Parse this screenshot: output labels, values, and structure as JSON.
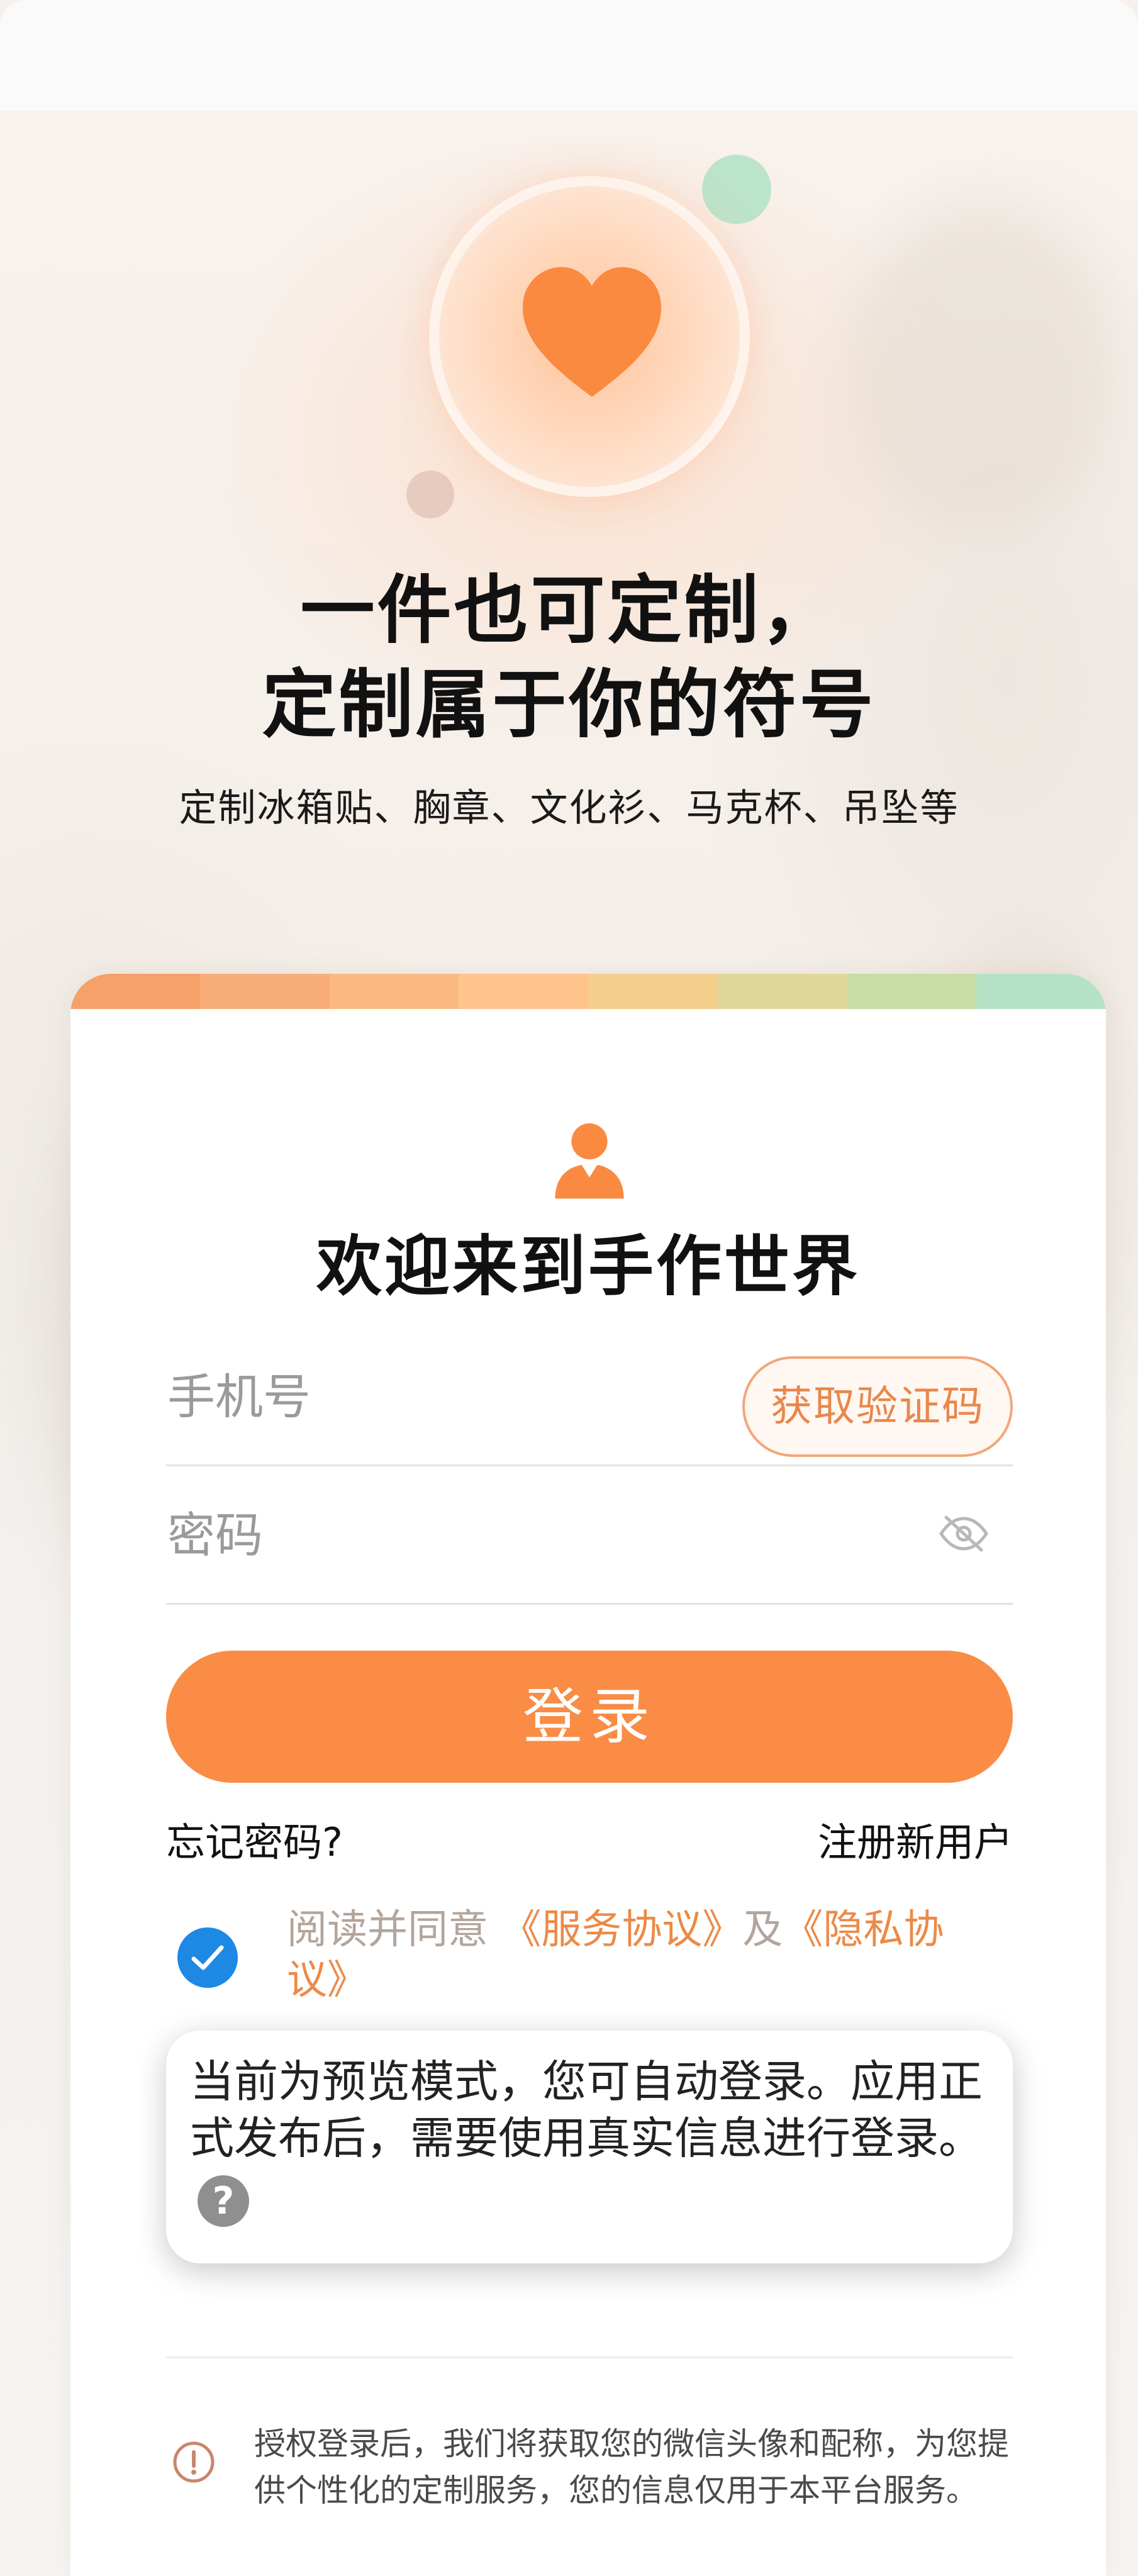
{
  "hero": {
    "headline_line1": "一件也可定制，",
    "headline_line2": "定制属于你的符号",
    "subtitle": "定制冰箱贴、胸章、文化衫、马克杯、吊坠等"
  },
  "login": {
    "welcome_title": "欢迎来到手作世界",
    "phone_placeholder": "手机号",
    "get_code_label": "获取验证码",
    "password_placeholder": "密码",
    "login_button": "登录",
    "forgot_password": "忘记密码?",
    "register": "注册新用户",
    "agreement": {
      "checked": true,
      "prefix": "阅读并同意 ",
      "service_link": "《服务协议》",
      "conjunction": "及",
      "privacy_link": "《隐私协议》"
    }
  },
  "preview_tip": {
    "text": "当前为预览模式，您可自动登录。应用正式发布后，需要使用真实信息进行登录。",
    "help_glyph": "?"
  },
  "notice": {
    "text": "授权登录后，我们将获取您的微信头像和配称，为您提供个性化的定制服务，您的信息仅用于本平台服务。"
  },
  "colors": {
    "accent": "#fa8c45",
    "accent_text": "#ec8a47",
    "check_blue": "#1e88e5",
    "stripe": [
      "#f7a16a",
      "#f9ad78",
      "#fbb97f",
      "#fdc58c",
      "#f5cf8c",
      "#e2d79b",
      "#c8dca5",
      "#b5e2c6"
    ]
  },
  "icons": {
    "hero": "heart-icon",
    "card": "user-icon",
    "password_toggle": "eye-off-icon",
    "agreement": "check-icon",
    "tip": "question-icon",
    "notice": "info-icon"
  }
}
